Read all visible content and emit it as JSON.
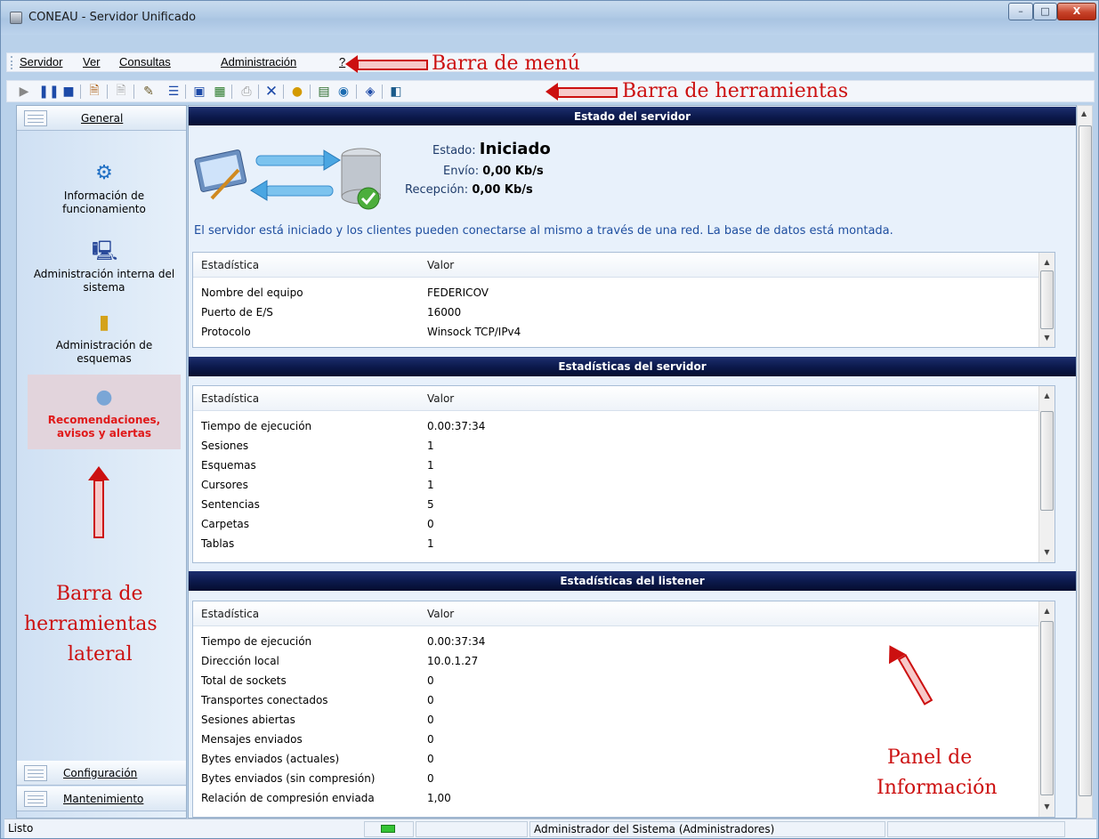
{
  "window": {
    "title": "CONEAU - Servidor Unificado",
    "minimize": "–",
    "maximize": "□",
    "close": "X"
  },
  "menu": {
    "items": [
      "Servidor",
      "Ver",
      "Consultas",
      "Administración",
      "?"
    ]
  },
  "annotations": {
    "menu_bar": "Barra de menú",
    "toolbar": "Barra de herramientas",
    "side_toolbar_1": "Barra de",
    "side_toolbar_2": "herramientas",
    "side_toolbar_3": "lateral",
    "info_panel_1": "Panel de",
    "info_panel_2": "Información"
  },
  "toolbar": {
    "icons": [
      "play-icon",
      "pause-icon",
      "stop-icon",
      "document-icon",
      "disabled-document-icon",
      "edit-icon",
      "tree-icon",
      "console-icon",
      "form-icon",
      "print-icon",
      "delete-icon",
      "help-icon",
      "folder-icon",
      "globe-icon",
      "info-icon",
      "exit-icon"
    ]
  },
  "sidebar": {
    "tabs": {
      "general": "General",
      "config": "Configuración",
      "maintenance": "Mantenimiento"
    },
    "items": [
      {
        "line1": "Información de",
        "line2": "funcionamiento"
      },
      {
        "line1": "Administración interna del",
        "line2": "sistema"
      },
      {
        "line1": "Administración de",
        "line2": "esquemas"
      },
      {
        "line1": "Recomendaciones,",
        "line2": "avisos y alertas"
      }
    ]
  },
  "server_status": {
    "header": "Estado del servidor",
    "estado_label": "Estado:",
    "estado_value": "Iniciado",
    "envio_label": "Envío:",
    "envio_value": "0,00 Kb/s",
    "recepcion_label": "Recepción:",
    "recepcion_value": "0,00 Kb/s",
    "description": "El servidor está iniciado y los clientes pueden conectarse al mismo a través de una red. La base de datos está montada.",
    "col1": "Estadística",
    "col2": "Valor",
    "rows": [
      [
        "Nombre del equipo",
        "FEDERICOV"
      ],
      [
        "Puerto de E/S",
        "16000"
      ],
      [
        "Protocolo",
        "Winsock TCP/IPv4"
      ]
    ]
  },
  "server_stats": {
    "header": "Estadísticas del servidor",
    "col1": "Estadística",
    "col2": "Valor",
    "rows": [
      [
        "Tiempo de ejecución",
        "0.00:37:34"
      ],
      [
        "Sesiones",
        "1"
      ],
      [
        "Esquemas",
        "1"
      ],
      [
        "Cursores",
        "1"
      ],
      [
        "Sentencias",
        "5"
      ],
      [
        "Carpetas",
        "0"
      ],
      [
        "Tablas",
        "1"
      ]
    ]
  },
  "listener_stats": {
    "header": "Estadísticas del listener",
    "col1": "Estadística",
    "col2": "Valor",
    "rows": [
      [
        "Tiempo de ejecución",
        "0.00:37:34"
      ],
      [
        "Dirección local",
        "10.0.1.27"
      ],
      [
        "Total de sockets",
        "0"
      ],
      [
        "Transportes conectados",
        "0"
      ],
      [
        "Sesiones abiertas",
        "0"
      ],
      [
        "Mensajes enviados",
        "0"
      ],
      [
        "Bytes enviados (actuales)",
        "0"
      ],
      [
        "Bytes enviados (sin compresión)",
        "0"
      ],
      [
        "Relación de compresión enviada",
        "1,00"
      ]
    ]
  },
  "statusbar": {
    "ready": "Listo",
    "user": "Administrador del Sistema (Administradores)"
  }
}
